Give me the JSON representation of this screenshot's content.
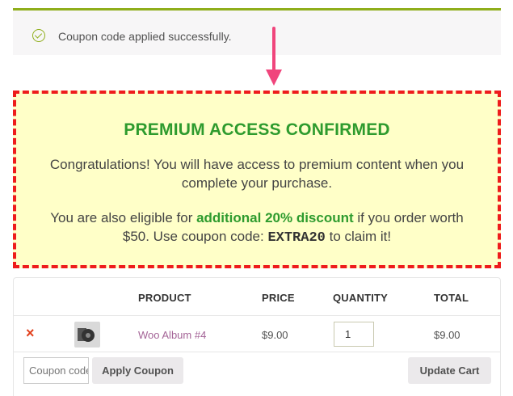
{
  "notice": {
    "message": "Coupon code applied successfully.",
    "icon": "check-circle-icon",
    "accent": "#8fae1b"
  },
  "annotation": {
    "arrow_color": "#f0457c"
  },
  "premium": {
    "title": "PREMIUM ACCESS CONFIRMED",
    "paragraph1": "Congratulations! You will have access to premium content when you complete your purchase.",
    "p2_before": "You are also eligible for ",
    "p2_highlight": "additional 20% discount",
    "p2_middle": " if you order worth $50. Use coupon code: ",
    "p2_code": "EXTRA20",
    "p2_after": " to claim it!",
    "border_color": "#ee1c1c",
    "background": "#ffffc8",
    "accent": "#2e9b2e"
  },
  "cart": {
    "headers": {
      "product": "PRODUCT",
      "price": "PRICE",
      "quantity": "QUANTITY",
      "total": "TOTAL"
    },
    "items": [
      {
        "remove_label": "×",
        "name": "Woo Album #4",
        "price": "$9.00",
        "quantity": "1",
        "total": "$9.00"
      }
    ],
    "coupon_placeholder": "Coupon code",
    "apply_label": "Apply Coupon",
    "update_label": "Update Cart"
  }
}
